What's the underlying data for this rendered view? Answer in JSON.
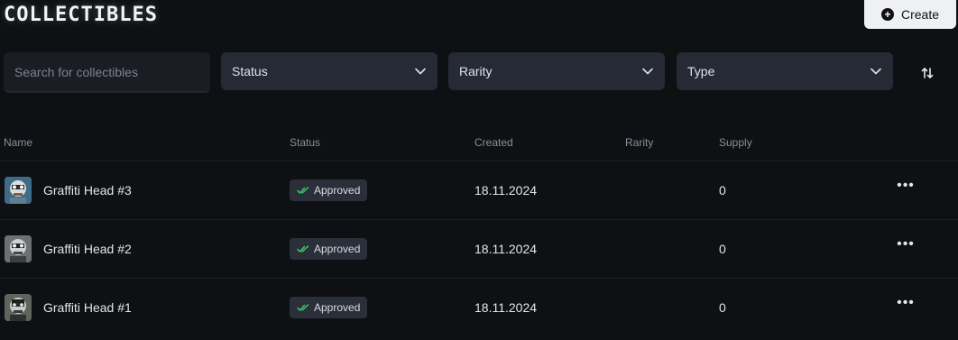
{
  "header": {
    "title": "COLLECTIBLES",
    "create_label": "Create"
  },
  "filters": {
    "search_placeholder": "Search for collectibles",
    "status_label": "Status",
    "rarity_label": "Rarity",
    "type_label": "Type"
  },
  "table": {
    "columns": {
      "name": "Name",
      "status": "Status",
      "created": "Created",
      "rarity": "Rarity",
      "supply": "Supply"
    },
    "rows": [
      {
        "name": "Graffiti Head #3",
        "status": "Approved",
        "created": "18.11.2024",
        "rarity": "",
        "supply": "0"
      },
      {
        "name": "Graffiti Head #2",
        "status": "Approved",
        "created": "18.11.2024",
        "rarity": "",
        "supply": "0"
      },
      {
        "name": "Graffiti Head #1",
        "status": "Approved",
        "created": "18.11.2024",
        "rarity": "",
        "supply": "0"
      }
    ]
  },
  "icons": {
    "create": "plus-circle-icon",
    "select": "chevron-down-icon",
    "sort": "sort-arrows-icon",
    "status": "double-check-icon",
    "row_menu": "more-horizontal-icon"
  },
  "colors": {
    "background": "#0e1014",
    "select_bg": "#252a35",
    "badge_bg": "#2a2f3a",
    "approved_check": "#3ecf6e"
  }
}
